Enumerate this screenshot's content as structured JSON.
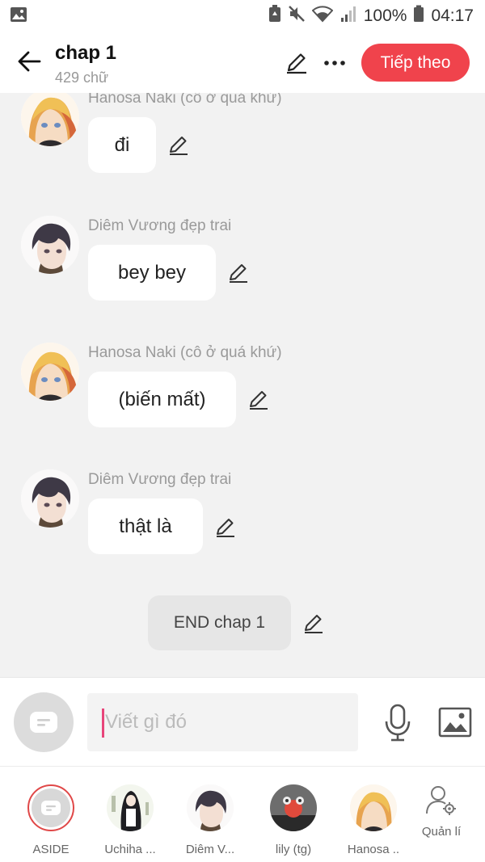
{
  "status_bar": {
    "battery": "100%",
    "time": "04:17",
    "icons": [
      "image-icon",
      "battery-saver-icon",
      "mute-icon",
      "wifi-icon",
      "signal-icon",
      "battery-icon"
    ]
  },
  "header": {
    "title": "chap 1",
    "word_count": "429 chữ",
    "next_label": "Tiếp theo",
    "accent_color": "#f0434c"
  },
  "messages": [
    {
      "sender": "Hanosa Naki (cô ở quá khứ)",
      "text": "đi",
      "avatar": "hanosa"
    },
    {
      "sender": "Diêm Vương đẹp trai",
      "text": "bey bey",
      "avatar": "diem"
    },
    {
      "sender": "Hanosa Naki (cô ở quá khứ)",
      "text": "(biến mất)",
      "avatar": "hanosa"
    },
    {
      "sender": "Diêm Vương đẹp trai",
      "text": "thật là",
      "avatar": "diem"
    }
  ],
  "end_marker": "END chap 1",
  "composer": {
    "placeholder": "Viết gì đó"
  },
  "characters": [
    {
      "label": "ASIDE"
    },
    {
      "label": "Uchiha ..."
    },
    {
      "label": "Diêm V..."
    },
    {
      "label": "lily (tg)"
    },
    {
      "label": "Hanosa .."
    }
  ],
  "manage_label": "Quản lí"
}
